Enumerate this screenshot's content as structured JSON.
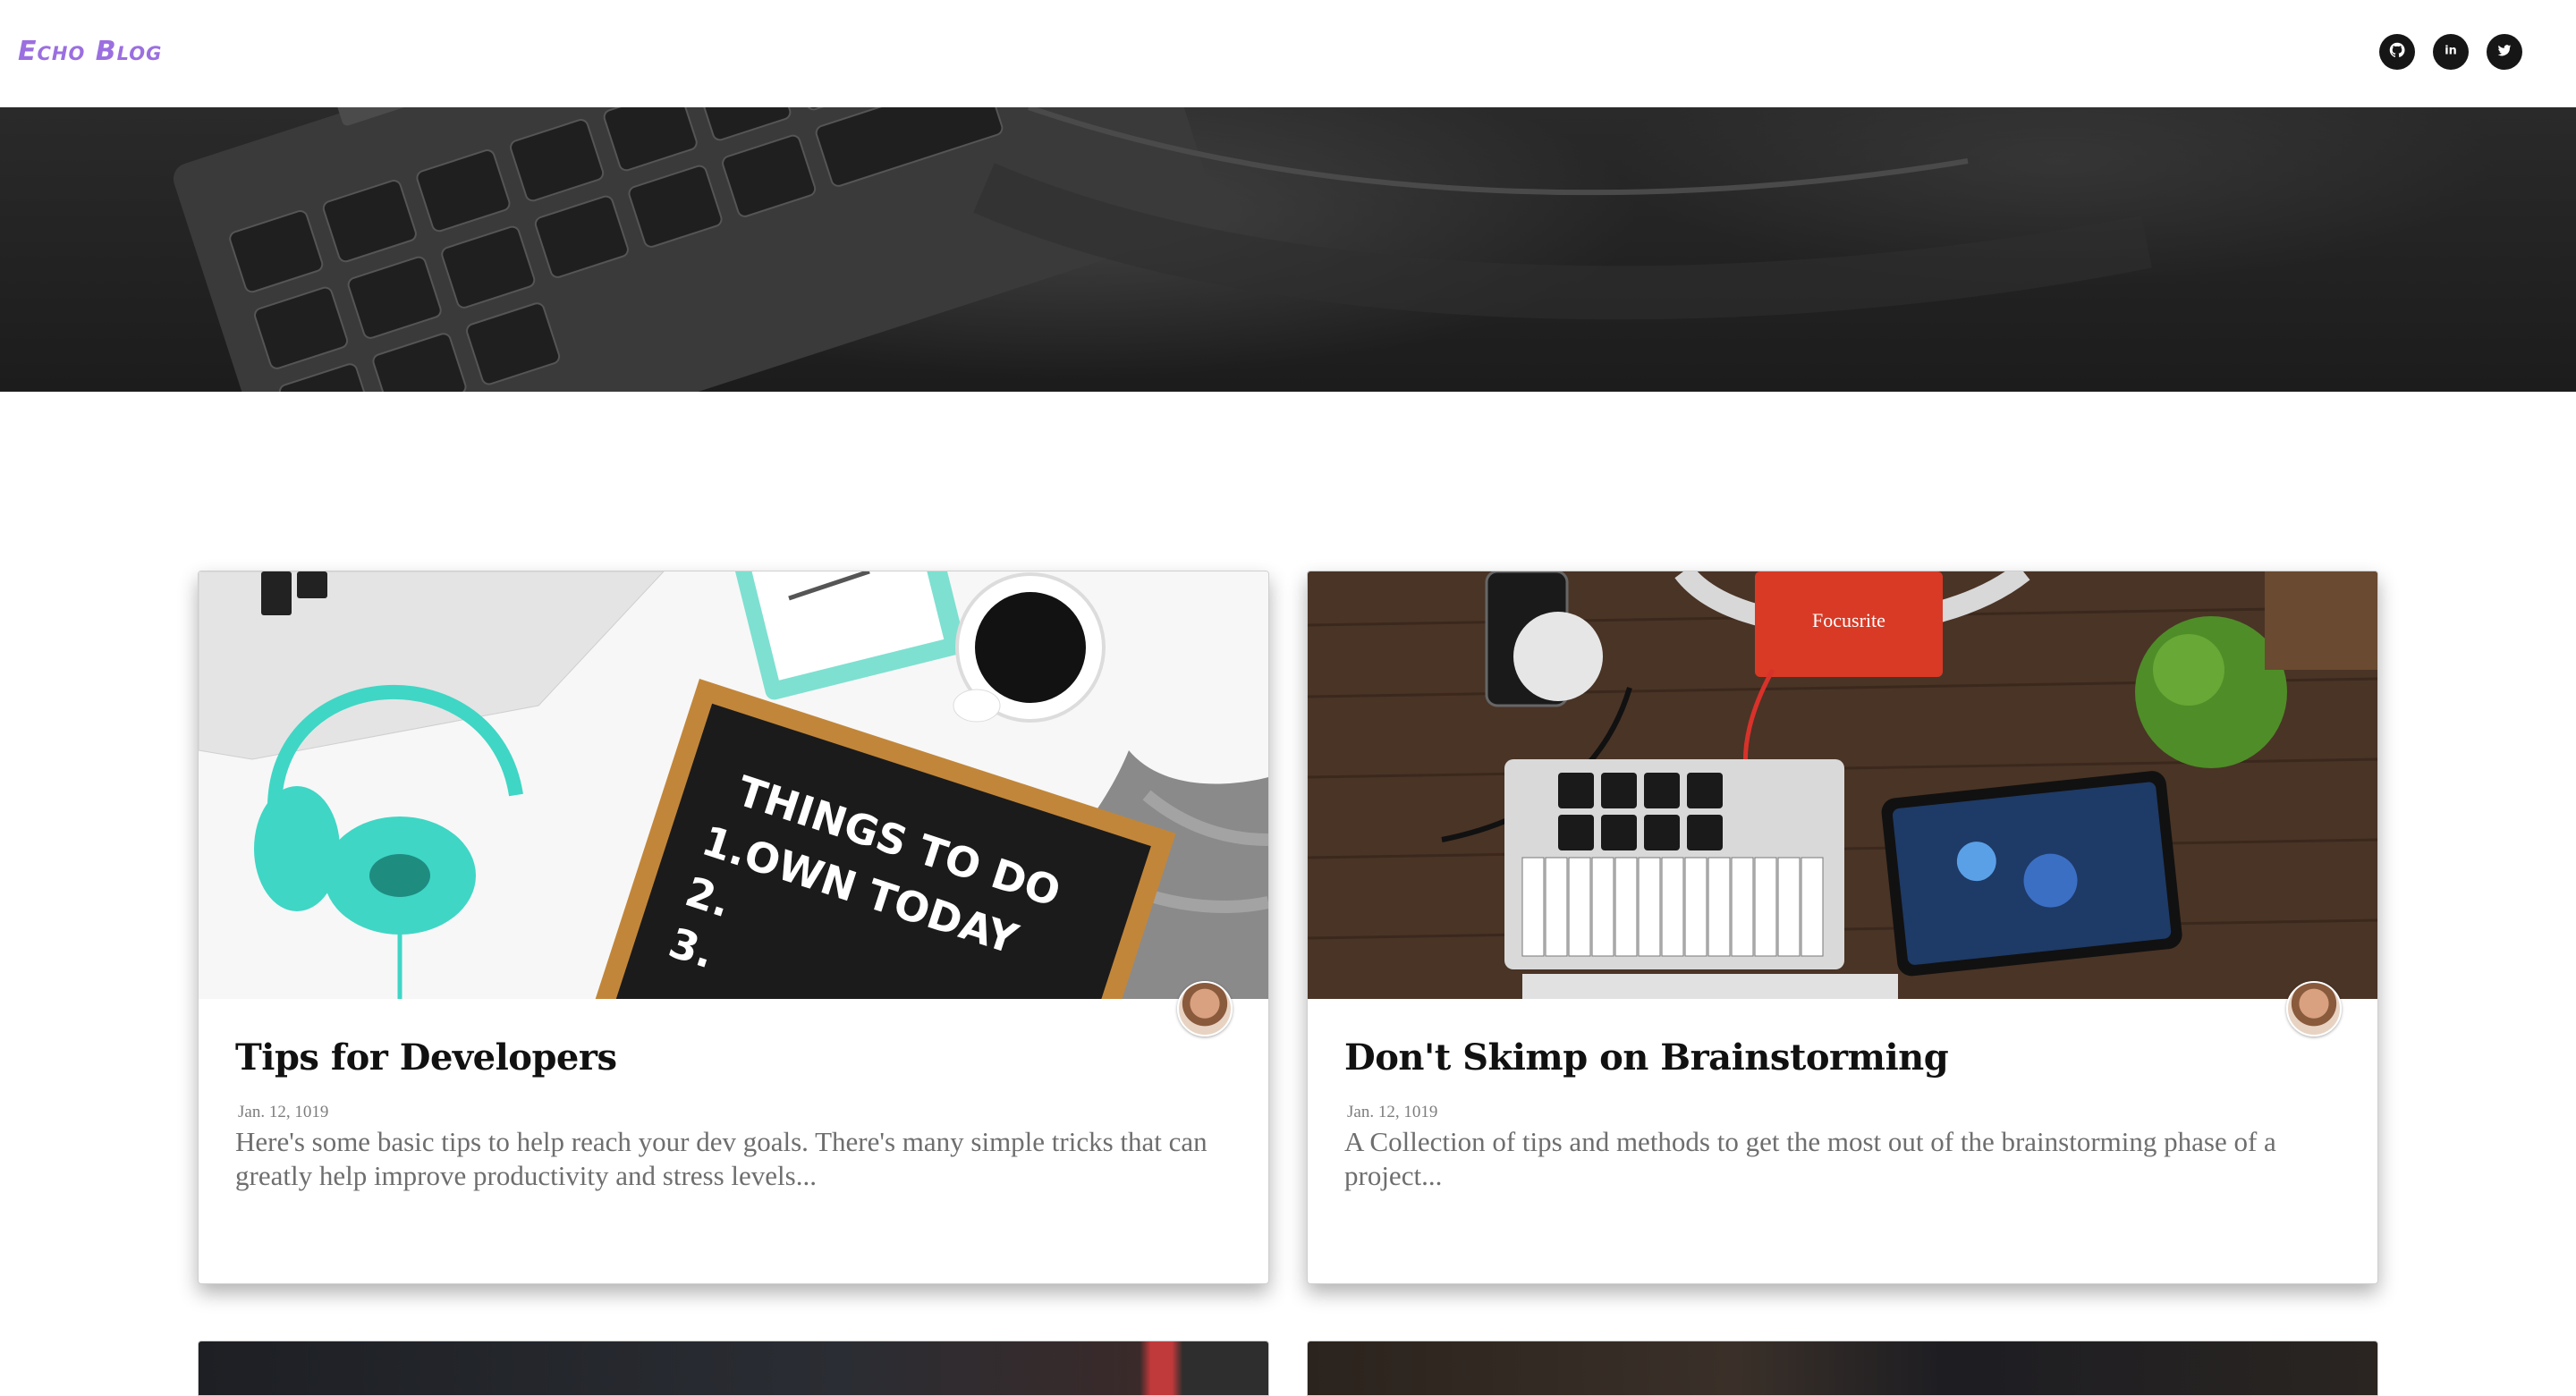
{
  "brand": {
    "name": "Echo Blog"
  },
  "social": [
    {
      "name": "github",
      "icon": "github-icon"
    },
    {
      "name": "linkedin",
      "icon": "linkedin-icon",
      "glyph": "in"
    },
    {
      "name": "twitter",
      "icon": "twitter-icon"
    }
  ],
  "hero": {
    "image": "keyboard-photo"
  },
  "posts": [
    {
      "title": "Tips for Developers",
      "date": "Jan. 12, 1019",
      "excerpt": "Here's some basic tips to help reach your dev goals. There's many simple tricks that can greatly help improve productivity and stress levels...",
      "image": "letterboard-headphones-photo",
      "image_text": [
        "THINGS TO DO",
        "1.OWN TODAY",
        "2.",
        "3."
      ]
    },
    {
      "title": "Don't Skimp on Brainstorming",
      "date": "Jan. 12, 1019",
      "excerpt": "A Collection of tips and methods to get the most out of the brainstorming phase of a project...",
      "image": "music-desk-photo",
      "image_text": [
        "Focusrite"
      ]
    }
  ],
  "colors": {
    "brand": "#9b6fe0",
    "title": "#111111",
    "muted": "#6e6e6e",
    "social_bg": "#161616"
  }
}
